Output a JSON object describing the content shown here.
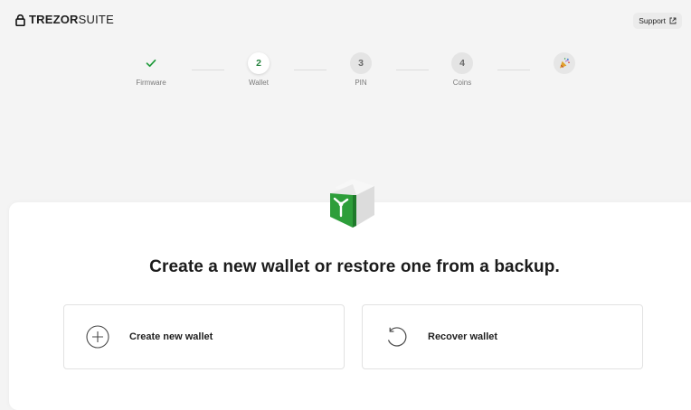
{
  "header": {
    "logo_bold": "TREZOR",
    "logo_light": "SUITE",
    "support_label": "Support"
  },
  "stepper": {
    "steps": [
      {
        "label": "Firmware",
        "number": "",
        "state": "done",
        "icon": "check-icon"
      },
      {
        "label": "Wallet",
        "number": "2",
        "state": "active"
      },
      {
        "label": "PIN",
        "number": "3",
        "state": "todo"
      },
      {
        "label": "Coins",
        "number": "4",
        "state": "todo"
      },
      {
        "label": "",
        "number": "",
        "state": "final",
        "icon": "party-popper-icon"
      }
    ]
  },
  "main": {
    "heading": "Create a new wallet or restore one from a backup.",
    "options": [
      {
        "label": "Create new wallet",
        "icon": "plus-circle-icon"
      },
      {
        "label": "Recover wallet",
        "icon": "recover-arrow-icon"
      }
    ]
  },
  "colors": {
    "accent_green": "#1f9a3a",
    "device_green": "#2d9e3a",
    "background": "#f4f4f4"
  }
}
